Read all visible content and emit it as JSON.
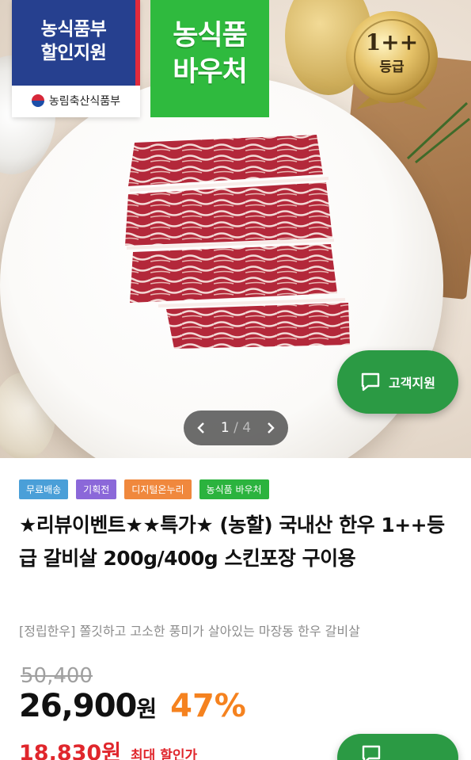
{
  "hero": {
    "gov_badge_lines": [
      "농식품부",
      "할인지원"
    ],
    "gov_ministry": "농림축산식품부",
    "voucher_lines": [
      "농식품",
      "바우처"
    ],
    "grade_lines": [
      "1++",
      "등급"
    ],
    "support_label": "고객지원",
    "pager": {
      "current": "1",
      "separator": "/",
      "total": "4"
    }
  },
  "product": {
    "tags": [
      {
        "label": "무료배송",
        "color": "#4a9fd8"
      },
      {
        "label": "기획전",
        "color": "#8b68d9"
      },
      {
        "label": "디지털온누리",
        "color": "#f0883d"
      },
      {
        "label": "농식품 바우처",
        "color": "#2bb33e"
      }
    ],
    "title": "★리뷰이벤트★★특가★ (농할) 국내산 한우 1++등급 갈비살 200g/400g 스킨포장 구이용",
    "subtitle": "[정립한우] 쫄깃하고 고소한 풍미가 살아있는 마장동 한우 갈비살",
    "original_price": "50,400",
    "price_number": "26,900",
    "price_unit": "원",
    "discount": "47%",
    "max_discount_price": "18,830원",
    "max_discount_label": "최대 할인가"
  },
  "colors": {
    "accent_green": "#2b9a44",
    "discount_orange": "#f5821f",
    "max_red": "#e0262c"
  }
}
